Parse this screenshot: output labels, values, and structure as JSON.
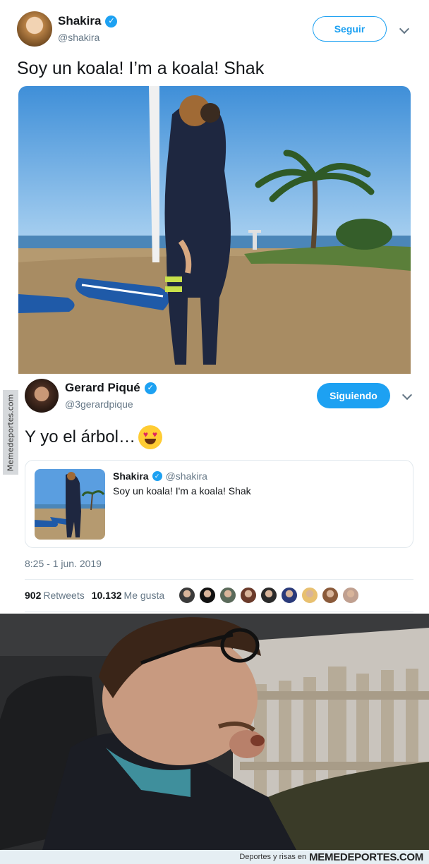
{
  "tweet1": {
    "name": "Shakira",
    "handle": "@shakira",
    "follow_label": "Seguir",
    "text": "Soy un koala! I’m a koala! Shak",
    "avatar_icon": "avatar-shakira"
  },
  "watermark": "Memedeportes.com",
  "tweet2": {
    "name": "Gerard Piqué",
    "handle": "@3gerardpique",
    "following_label": "Siguiendo",
    "text": "Y yo el árbol…",
    "emoji": "heart-eyes-emoji",
    "quote": {
      "name": "Shakira",
      "handle": "@shakira",
      "text": "Soy un koala! I'm a koala! Shak"
    },
    "timestamp": "8:25 - 1 jun. 2019",
    "retweets_count": "902",
    "retweets_label": "Retweets",
    "likes_count": "10.132",
    "likes_label": "Me gusta",
    "liker_colors": [
      "#3a3a3a",
      "#111111",
      "#5a6a5a",
      "#6a3a2a",
      "#2a2a2a",
      "#2a3a7a",
      "#e8c070",
      "#8a5a3a",
      "#c0a090"
    ]
  },
  "footer": {
    "small": "Deportes y risas en",
    "brand": "MEMEDEPORTES.COM"
  },
  "colors": {
    "accent": "#1da1f2",
    "secondary_text": "#657786",
    "border": "#e1e8ed"
  }
}
